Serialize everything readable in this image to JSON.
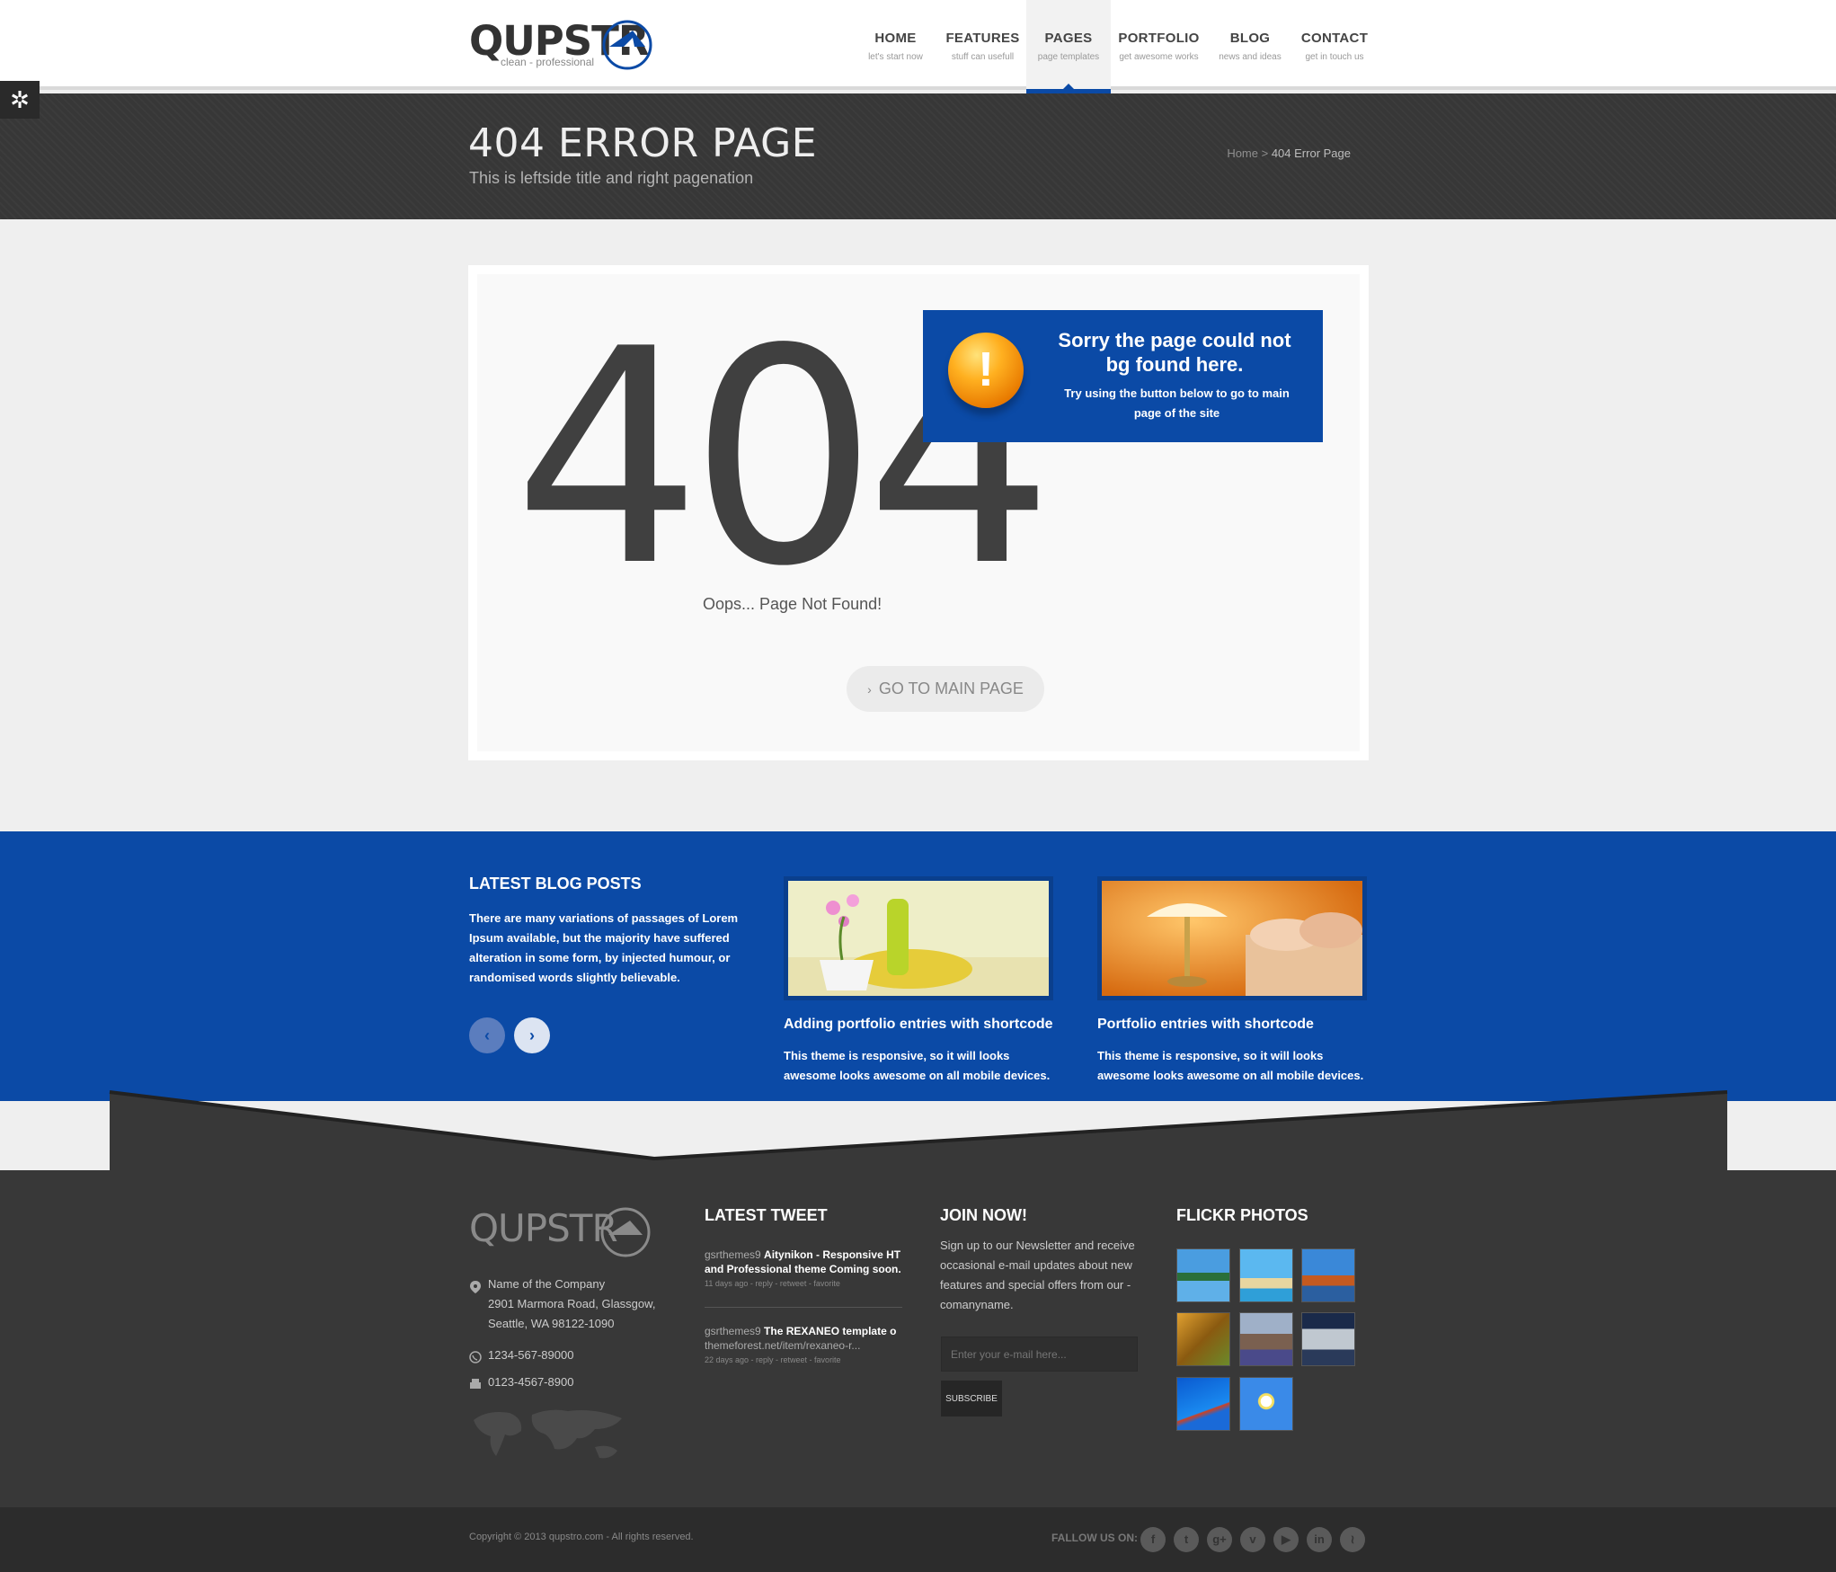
{
  "logo": {
    "word": "QUPSTR",
    "tagline": "clean - professional"
  },
  "nav": [
    {
      "label": "HOME",
      "sub": "let's start now"
    },
    {
      "label": "FEATURES",
      "sub": "stuff can usefull"
    },
    {
      "label": "PAGES",
      "sub": "page templates"
    },
    {
      "label": "PORTFOLIO",
      "sub": "get awesome works"
    },
    {
      "label": "BLOG",
      "sub": "news and ideas"
    },
    {
      "label": "CONTACT",
      "sub": "get in touch us"
    }
  ],
  "title_bar": {
    "title": "404 ERROR PAGE",
    "subtitle": "This is leftside title and right pagenation",
    "breadcrumb_home": "Home",
    "breadcrumb_sep": " > ",
    "breadcrumb_current": "404 Error Page"
  },
  "error": {
    "code": "404",
    "message": "Oops... Page Not Found!",
    "button": "GO TO MAIN PAGE",
    "notice_title": "Sorry the page could not bg found here.",
    "notice_text": "Try using the button below to go to main page of the site"
  },
  "blog": {
    "heading": "LATEST BLOG POSTS",
    "intro": "There are many variations of passages of Lorem Ipsum available, but the majority have suffered alteration in some form, by injected humour, or randomised words slightly believable.",
    "posts": [
      {
        "title": "Adding portfolio entries with shortcode",
        "text": "This theme is responsive, so it will looks awesome looks awesome on all mobile devices."
      },
      {
        "title": "Portfolio entries with shortcode",
        "text": "This theme is responsive, so it will looks awesome looks awesome on all mobile devices."
      }
    ]
  },
  "footer": {
    "logo_word": "QUPSTR",
    "address": [
      "Name of the Company",
      "2901 Marmora Road, Glassgow,",
      "Seattle, WA 98122-1090"
    ],
    "phone": "1234-567-89000",
    "fax": "0123-4567-8900",
    "tweet_heading": "LATEST TWEET",
    "tweets": [
      {
        "user": "gsrthemes9",
        "text": "Aitynikon - Responsive HT",
        "line2": "and Professional theme Coming soon.",
        "meta": "11 days ago - reply - retweet - favorite"
      },
      {
        "user": "gsrthemes9",
        "text": "The REXANEO template o",
        "line2": "themeforest.net/item/rexaneo-r...",
        "meta": "22 days ago - reply - retweet - favorite"
      }
    ],
    "join_heading": "JOIN NOW!",
    "join_text": "Sign up to our Newsletter and receive occasional e-mail updates about new features and special offers from our - comanyname.",
    "email_placeholder": "Enter your e-mail here...",
    "subscribe": "SUBSCRIBE",
    "flickr_heading": "FLICKR PHOTOS",
    "copyright": "Copyright © 2013 qupstro.com - All rights reserved.",
    "follow": "FALLOW US ON:"
  },
  "colors": {
    "brand_blue": "#0b4aa6",
    "dark": "#383838",
    "warning_orange": "#f59a12"
  }
}
